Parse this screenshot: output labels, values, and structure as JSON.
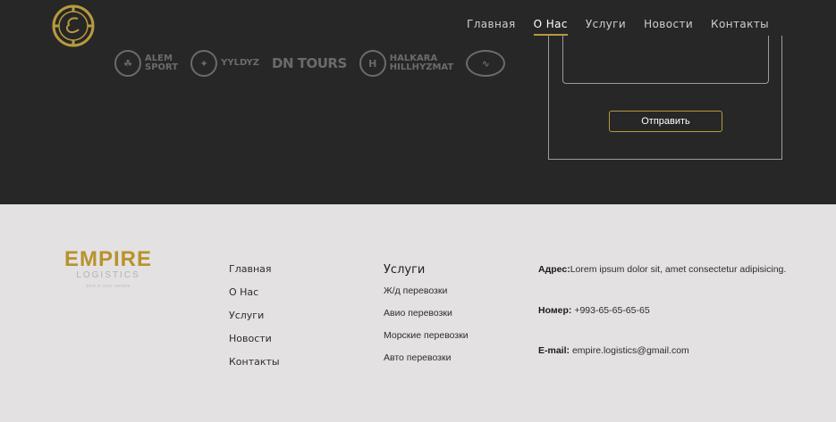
{
  "nav": {
    "items": [
      "Главная",
      "О Нас",
      "Услуги",
      "Новости",
      "Контакты"
    ],
    "active_index": 1
  },
  "partners": [
    {
      "line1": "ALEM",
      "line2": "SPORT"
    },
    {
      "line1": "YYLDYZ",
      "line2": ""
    },
    {
      "line1": "DN TOURS",
      "line2": ""
    },
    {
      "line1": "HALKARA",
      "line2": "HILLHYZMAT"
    }
  ],
  "form": {
    "send_label": "Отправить"
  },
  "footer": {
    "brand": {
      "name": "EMPIRE",
      "sub": "LOGISTICS",
      "tagline": "best in your service"
    },
    "links": [
      "Главная",
      "О Нас",
      "Услуги",
      "Новости",
      "Контакты"
    ],
    "services": {
      "title": "Услуги",
      "items": [
        "Ж/д перевозки",
        "Авио перевозки",
        "Морские перевозки",
        "Авто перевозки"
      ]
    },
    "contacts": {
      "address_label": "Адрес:",
      "address_value": "Lorem ipsum dolor sit, amet consectetur adipisicing.",
      "phone_label": "Номер:",
      "phone_value": "+993-65-65-65-65",
      "email_label": "E-mail:",
      "email_value": "empire.logistics@gmail.com"
    }
  },
  "colors": {
    "accent": "#b89a3e",
    "dark_bg": "#272727",
    "footer_bg": "#e3e1e1"
  }
}
